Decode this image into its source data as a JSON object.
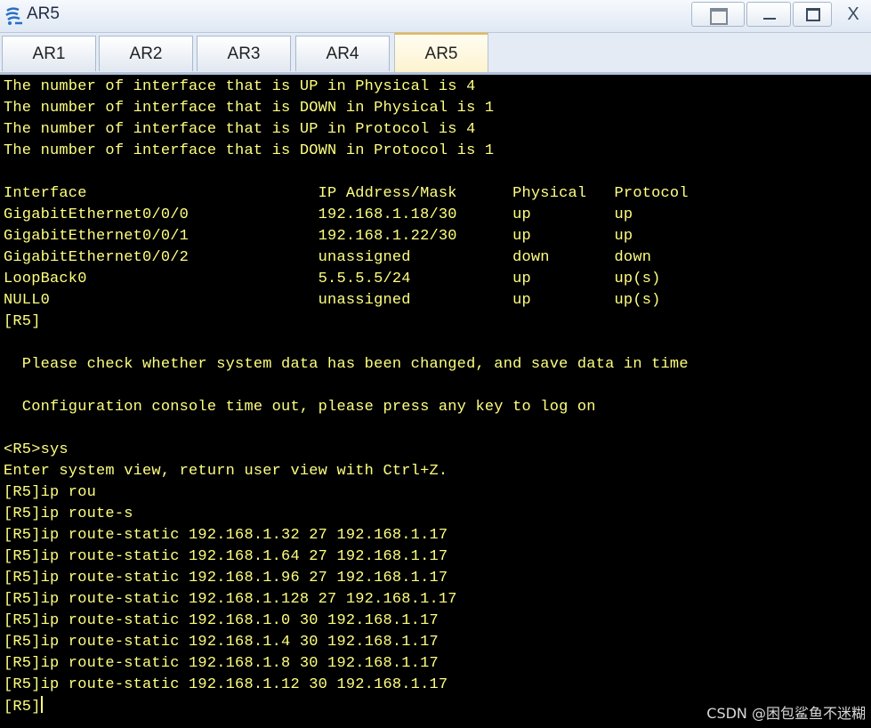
{
  "window": {
    "title": "AR5",
    "icon": "router-app-icon",
    "close_label": "X"
  },
  "tabs": [
    {
      "label": "AR1",
      "active": false
    },
    {
      "label": "AR2",
      "active": false
    },
    {
      "label": "AR3",
      "active": false
    },
    {
      "label": "AR4",
      "active": false
    },
    {
      "label": "AR5",
      "active": true
    }
  ],
  "terminal": {
    "text_color": "#ffff80",
    "background": "#000000",
    "lines": [
      "The number of interface that is UP in Physical is 4",
      "The number of interface that is DOWN in Physical is 1",
      "The number of interface that is UP in Protocol is 4",
      "The number of interface that is DOWN in Protocol is 1",
      "",
      "Interface                         IP Address/Mask      Physical   Protocol",
      "GigabitEthernet0/0/0              192.168.1.18/30      up         up",
      "GigabitEthernet0/0/1              192.168.1.22/30      up         up",
      "GigabitEthernet0/0/2              unassigned           down       down",
      "LoopBack0                         5.5.5.5/24           up         up(s)",
      "NULL0                             unassigned           up         up(s)",
      "[R5]",
      "",
      "  Please check whether system data has been changed, and save data in time",
      "",
      "  Configuration console time out, please press any key to log on",
      "",
      "<R5>sys",
      "Enter system view, return user view with Ctrl+Z.",
      "[R5]ip rou",
      "[R5]ip route-s",
      "[R5]ip route-static 192.168.1.32 27 192.168.1.17",
      "[R5]ip route-static 192.168.1.64 27 192.168.1.17",
      "[R5]ip route-static 192.168.1.96 27 192.168.1.17",
      "[R5]ip route-static 192.168.1.128 27 192.168.1.17",
      "[R5]ip route-static 192.168.1.0 30 192.168.1.17",
      "[R5]ip route-static 192.168.1.4 30 192.168.1.17",
      "[R5]ip route-static 192.168.1.8 30 192.168.1.17",
      "[R5]ip route-static 192.168.1.12 30 192.168.1.17",
      "[R5]"
    ]
  },
  "watermark": "CSDN @困包鲨鱼不迷糊"
}
